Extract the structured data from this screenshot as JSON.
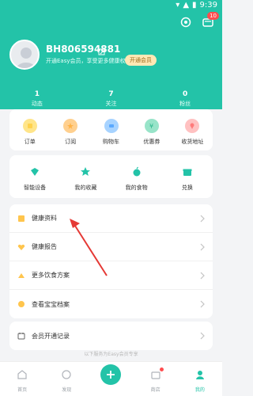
{
  "status_bar": {
    "time": "9:39"
  },
  "header": {
    "notification_count": "10",
    "username": "BH806594881",
    "tagline": "开通Easy会员，享受更多健康权益",
    "vip_button": "开通会员"
  },
  "stats": [
    {
      "value": "1",
      "label": "动态"
    },
    {
      "value": "7",
      "label": "关注"
    },
    {
      "value": "0",
      "label": "粉丝"
    }
  ],
  "grid1": [
    {
      "label": "订单",
      "color": "#ffd24d"
    },
    {
      "label": "订阅",
      "color": "#ffb347"
    },
    {
      "label": "购物车",
      "color": "#5aa9ff"
    },
    {
      "label": "优惠券",
      "color": "#4cd1a5"
    },
    {
      "label": "收货地址",
      "color": "#ff7b7b"
    }
  ],
  "grid2": [
    {
      "label": "智能设备",
      "color": "#23c3a8"
    },
    {
      "label": "我的收藏",
      "color": "#23c3a8"
    },
    {
      "label": "我的食物",
      "color": "#23c3a8"
    },
    {
      "label": "兑换",
      "color": "#23c3a8"
    }
  ],
  "health": [
    {
      "label": "健康资料"
    },
    {
      "label": "健康报告"
    },
    {
      "label": "更多饮食方案"
    },
    {
      "label": "查看宝宝档案"
    }
  ],
  "vip_record": {
    "label": "会员开通记录"
  },
  "footer_divider": "以下服务为Easy会员专享",
  "tabs": [
    {
      "label": "首页"
    },
    {
      "label": "发现"
    },
    {
      "label": ""
    },
    {
      "label": "商店"
    },
    {
      "label": "我的"
    }
  ],
  "colors": {
    "brand": "#23c3a8"
  }
}
